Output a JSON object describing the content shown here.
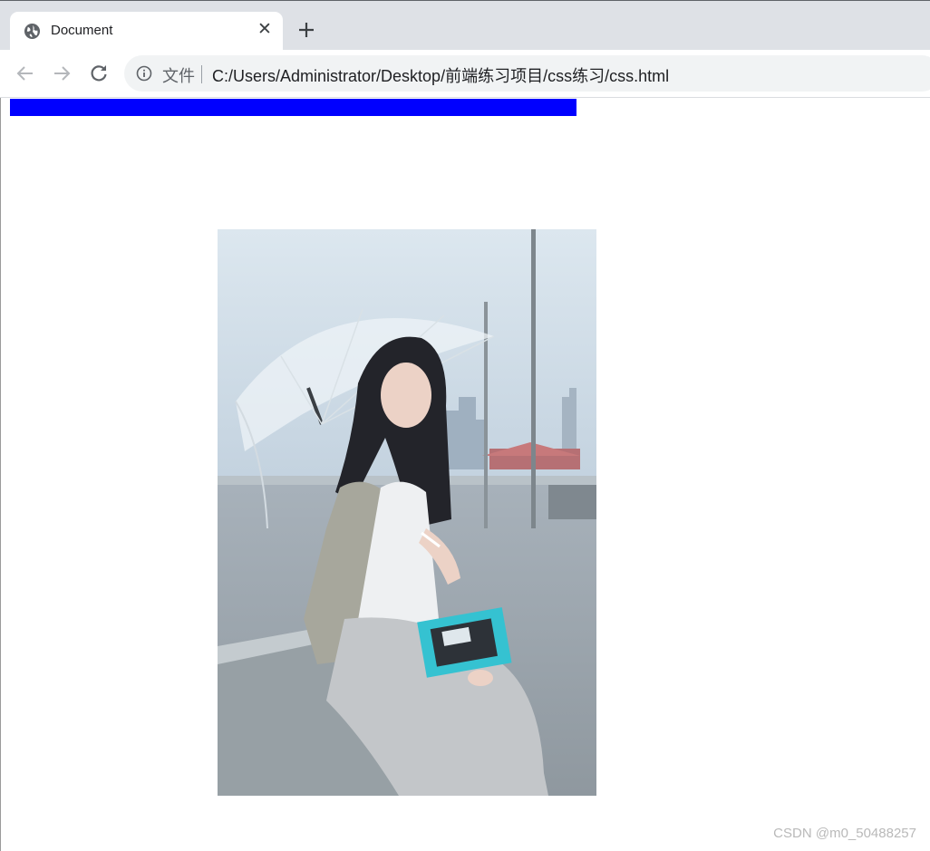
{
  "browser": {
    "tab": {
      "title": "Document",
      "favicon": "globe-icon",
      "close_glyph": "✕"
    },
    "new_tab_icon": "plus-icon",
    "toolbar": {
      "back_icon": "arrow-left-icon",
      "forward_icon": "arrow-right-icon",
      "reload_icon": "reload-icon",
      "site_info_icon": "info-icon",
      "scheme_label": "文件",
      "url": "C:/Users/Administrator/Desktop/前端练习项目/css练习/css.html"
    }
  },
  "page": {
    "bar_color": "#0000ff",
    "photo": "photo of a woman with a clear umbrella sitting on a rooftop ledge holding a teal book",
    "watermark": "CSDN @m0_50488257"
  }
}
